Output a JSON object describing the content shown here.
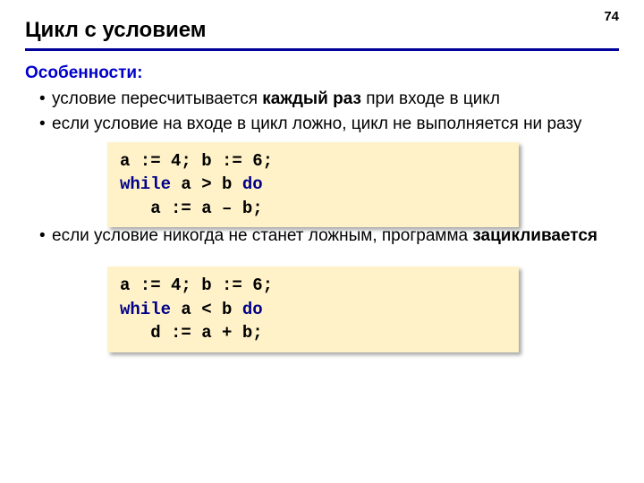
{
  "page_number": "74",
  "title": "Цикл с условием",
  "subhead": "Особенности:",
  "bullets": {
    "b1a": "условие пересчитывается ",
    "b1b": "каждый раз",
    "b1c": " при входе в цикл",
    "b2": "если условие на входе в цикл ложно, цикл не выполняется ни разу",
    "b3a": "если условие никогда не станет ложным, программа ",
    "b3b": "зацикливается"
  },
  "code1": {
    "l1": "a := 4; b := 6;",
    "l2a": "while",
    "l2b": " a > b ",
    "l2c": "do",
    "l3": "   a := a – b;"
  },
  "code2": {
    "l1": "a := 4; b := 6;",
    "l2a": "while",
    "l2b": " a < b ",
    "l2c": "do",
    "l3": "   d := a + b;"
  }
}
